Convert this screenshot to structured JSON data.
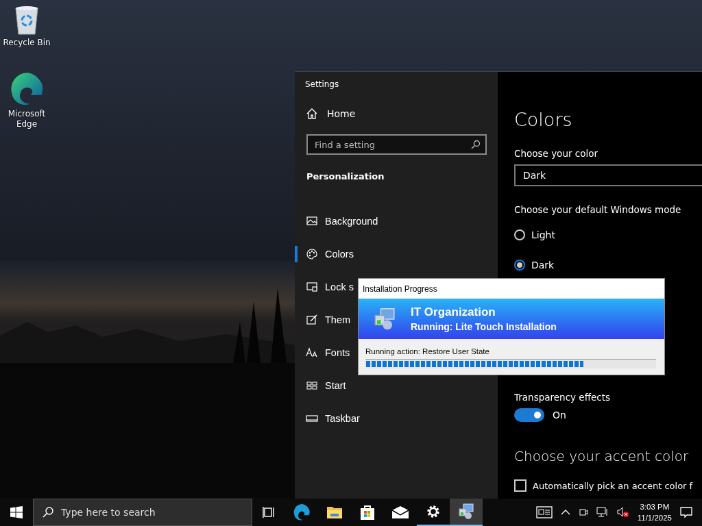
{
  "desktop_icons": [
    {
      "label": "Recycle Bin",
      "kind": "recycle"
    },
    {
      "label": "Microsoft Edge",
      "kind": "edge"
    }
  ],
  "settings": {
    "title": "Settings",
    "home": "Home",
    "search": {
      "placeholder": "Find a setting"
    },
    "section": "Personalization",
    "nav": [
      {
        "label": "Background",
        "kind": "image",
        "selected": false
      },
      {
        "label": "Colors",
        "kind": "palette",
        "selected": true
      },
      {
        "label": "Lock s",
        "kind": "lock",
        "selected": false
      },
      {
        "label": "Them",
        "kind": "brush",
        "selected": false
      },
      {
        "label": "Fonts",
        "kind": "fonts",
        "selected": false
      },
      {
        "label": "Start",
        "kind": "start",
        "selected": false
      },
      {
        "label": "Taskbar",
        "kind": "taskbar",
        "selected": false
      }
    ],
    "content": {
      "heading": "Colors",
      "color_label": "Choose your color",
      "color_value": "Dark",
      "mode_label": "Choose your default Windows mode",
      "modes": [
        {
          "label": "Light",
          "selected": false
        },
        {
          "label": "Dark",
          "selected": true
        }
      ],
      "transparency_label": "Transparency effects",
      "transparency": {
        "on": true,
        "label": "On"
      },
      "accent_heading": "Choose your accent color",
      "auto_accent": {
        "label": "Automatically pick an accent color f",
        "checked": false
      }
    }
  },
  "dialog": {
    "title": "Installation Progress",
    "organization": "IT Organization",
    "subtitle": "Running: Lite Touch Installation",
    "action": "Running action: Restore User State",
    "level": 0.75
  },
  "taskbar": {
    "search_placeholder": "Type here to search",
    "apps": [
      {
        "kind": "taskview",
        "running": false,
        "selected": false
      },
      {
        "kind": "edge",
        "running": false,
        "selected": false
      },
      {
        "kind": "folder",
        "running": false,
        "selected": false
      },
      {
        "kind": "store",
        "running": false,
        "selected": false
      },
      {
        "kind": "mail",
        "running": false,
        "selected": false
      },
      {
        "kind": "gear",
        "running": true,
        "selected": false
      },
      {
        "kind": "installer",
        "running": true,
        "selected": true
      }
    ],
    "time": "3:03 PM",
    "date": "11/1/2025"
  }
}
